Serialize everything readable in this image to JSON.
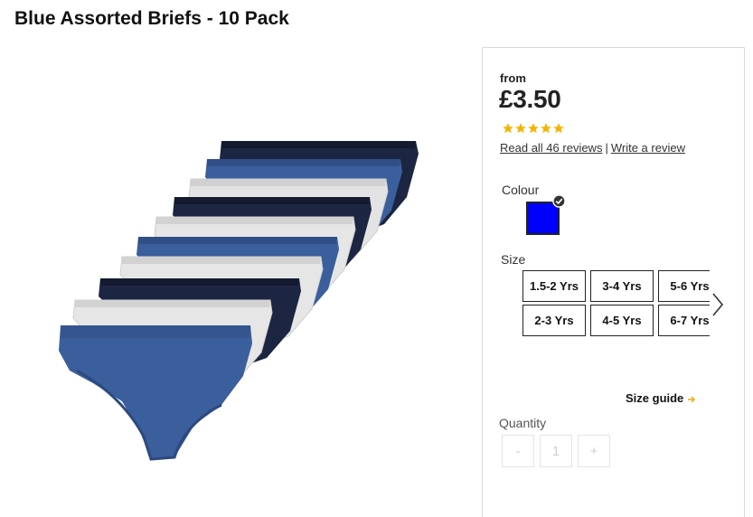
{
  "product": {
    "title": "Blue Assorted Briefs - 10 Pack"
  },
  "pricing": {
    "from_label": "from",
    "price": "£3.50"
  },
  "rating": {
    "stars": 5,
    "max_stars": 5,
    "star_color": "#f5b301"
  },
  "reviews": {
    "read_label": "Read all 46 reviews",
    "separator": "|",
    "write_label": "Write a review"
  },
  "colour": {
    "label": "Colour",
    "selected_color": "#0000ff",
    "selected_icon": "check-icon"
  },
  "size": {
    "label": "Size",
    "options": [
      "1.5-2 Yrs",
      "3-4 Yrs",
      "5-6 Yrs",
      "2-3 Yrs",
      "4-5 Yrs",
      "6-7 Yrs"
    ],
    "next_icon": "chevron-right-icon"
  },
  "size_guide": {
    "label": "Size guide",
    "icon": "arrow-right-icon",
    "icon_color": "#f5a800"
  },
  "quantity": {
    "label": "Quantity",
    "minus": "-",
    "value": "1",
    "plus": "+"
  },
  "image": {
    "palette": [
      "#3b5e9c",
      "#1c2541",
      "#e6e6e6"
    ]
  }
}
